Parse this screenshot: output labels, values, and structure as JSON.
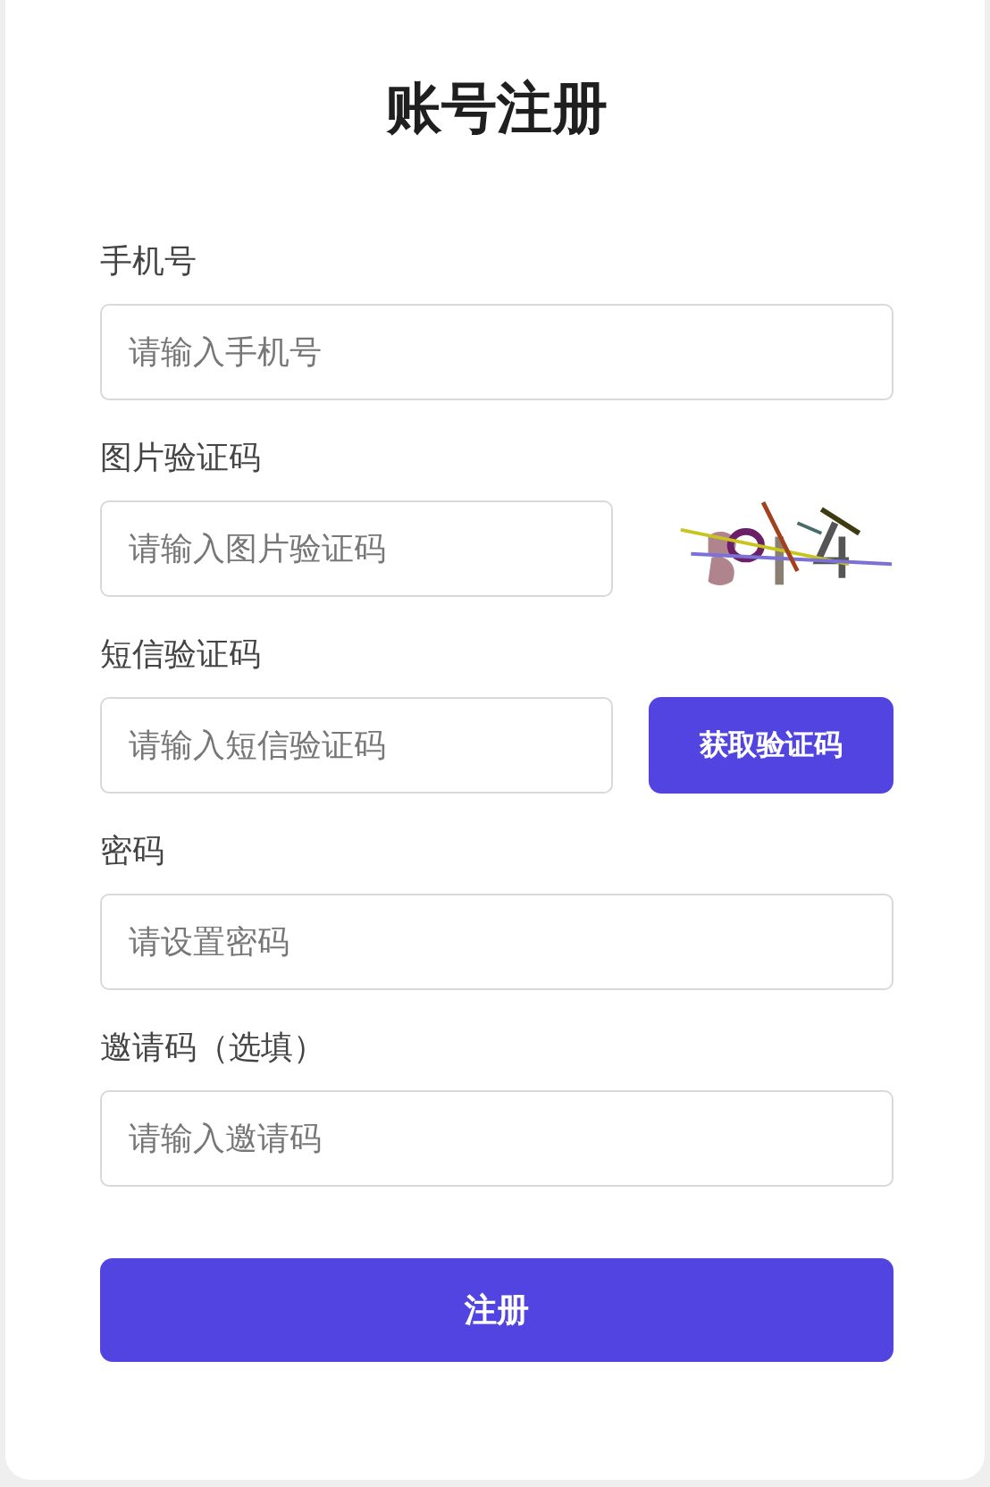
{
  "title": "账号注册",
  "fields": [
    {
      "kind": "text",
      "label": "手机号",
      "placeholder": "请输入手机号"
    },
    {
      "kind": "captcha",
      "label": "图片验证码",
      "placeholder": "请输入图片验证码"
    },
    {
      "kind": "sms",
      "label": "短信验证码",
      "placeholder": "请输入短信验证码",
      "button": "获取验证码"
    },
    {
      "kind": "text",
      "label": "密码",
      "placeholder": "请设置密码"
    },
    {
      "kind": "text",
      "label": "邀请码（选填）",
      "placeholder": "请输入邀请码"
    }
  ],
  "submit": "注册"
}
